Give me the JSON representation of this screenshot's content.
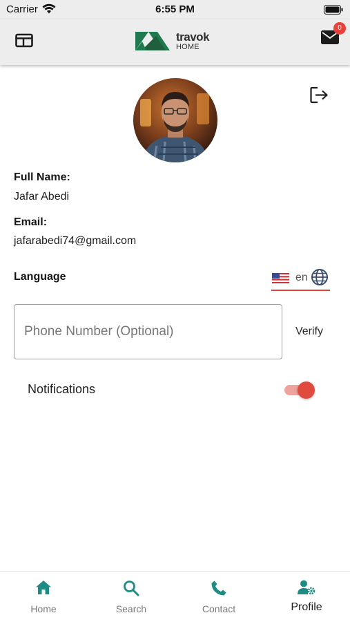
{
  "status_bar": {
    "carrier": "Carrier",
    "time": "6:55 PM",
    "icons": [
      "wifi-icon",
      "battery-icon"
    ]
  },
  "header": {
    "menu_icon": "window-icon",
    "logo": {
      "word": "travok",
      "sub": "HOME",
      "color": "#1f7a4d"
    },
    "mail_icon": "mail-icon",
    "mail_badge": "0"
  },
  "profile": {
    "logout_icon": "logout-icon",
    "full_name_label": "Full Name:",
    "full_name": "Jafar Abedi",
    "email_label": "Email:",
    "email": "jafarabedi74@gmail.com",
    "language_label": "Language",
    "language_code": "en",
    "phone_placeholder": "Phone Number (Optional)",
    "phone_value": "",
    "verify_label": "Verify",
    "notifications_label": "Notifications",
    "notifications_enabled": true
  },
  "colors": {
    "accent": "#e14a3f",
    "nav_icon": "#1f8c83",
    "header_bg": "#ededed"
  },
  "bottom_nav": [
    {
      "label": "Home",
      "icon": "home-icon",
      "active": false
    },
    {
      "label": "Search",
      "icon": "search-icon",
      "active": false
    },
    {
      "label": "Contact",
      "icon": "phone-icon",
      "active": false
    },
    {
      "label": "Profile",
      "icon": "user-settings-icon",
      "active": true
    }
  ]
}
